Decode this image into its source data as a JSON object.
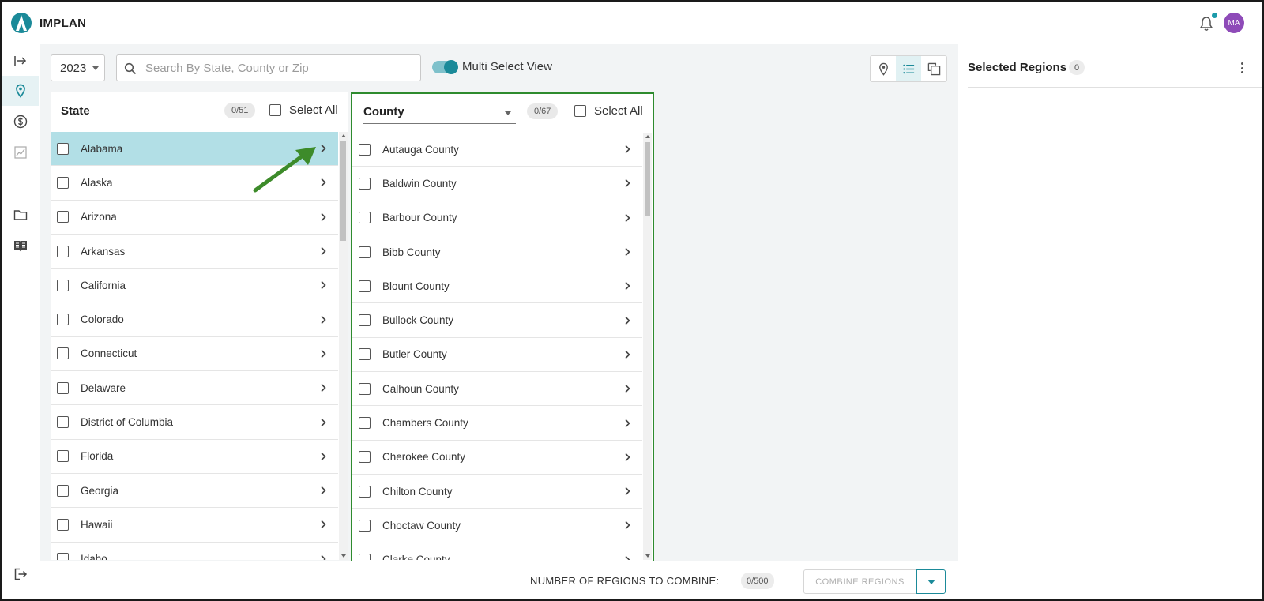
{
  "app": {
    "brand": "IMPLAN",
    "avatar_initials": "MA",
    "accent_color": "#1b8a99",
    "notification_dot_color": "#1b9aaa"
  },
  "sidebar": {
    "items": [
      {
        "icon": "expand-arrow-icon"
      },
      {
        "icon": "map-pin-icon",
        "active": true
      },
      {
        "icon": "dollar-icon"
      },
      {
        "icon": "chart-icon"
      },
      {
        "icon": "folder-icon"
      },
      {
        "icon": "book-icon"
      },
      {
        "icon": "logout-icon"
      }
    ]
  },
  "toolbar": {
    "year": "2023",
    "search_placeholder": "Search By State, County or Zip",
    "search_value": "",
    "multi_select_label": "Multi Select View",
    "multi_select_on": true,
    "views": [
      "map-pin-icon",
      "list-icon",
      "copy-icon"
    ],
    "active_view": "list-icon"
  },
  "state_panel": {
    "title": "State",
    "count": "0/51",
    "select_all_label": "Select All",
    "items": [
      {
        "label": "Alabama",
        "selected": true
      },
      {
        "label": "Alaska"
      },
      {
        "label": "Arizona"
      },
      {
        "label": "Arkansas"
      },
      {
        "label": "California"
      },
      {
        "label": "Colorado"
      },
      {
        "label": "Connecticut"
      },
      {
        "label": "Delaware"
      },
      {
        "label": "District of Columbia"
      },
      {
        "label": "Florida"
      },
      {
        "label": "Georgia"
      },
      {
        "label": "Hawaii"
      },
      {
        "label": "Idaho"
      }
    ]
  },
  "county_panel": {
    "dropdown_label": "County",
    "count": "0/67",
    "select_all_label": "Select All",
    "highlight_color": "#2e8b2e",
    "items": [
      {
        "label": "Autauga County"
      },
      {
        "label": "Baldwin County"
      },
      {
        "label": "Barbour County"
      },
      {
        "label": "Bibb County"
      },
      {
        "label": "Blount County"
      },
      {
        "label": "Bullock County"
      },
      {
        "label": "Butler County"
      },
      {
        "label": "Calhoun County"
      },
      {
        "label": "Chambers County"
      },
      {
        "label": "Cherokee County"
      },
      {
        "label": "Chilton County"
      },
      {
        "label": "Choctaw County"
      },
      {
        "label": "Clarke County"
      }
    ]
  },
  "selected_regions": {
    "title": "Selected Regions",
    "count": "0"
  },
  "footer": {
    "label": "NUMBER OF REGIONS TO COMBINE:",
    "count": "0/500",
    "combine_label": "COMBINE REGIONS"
  }
}
